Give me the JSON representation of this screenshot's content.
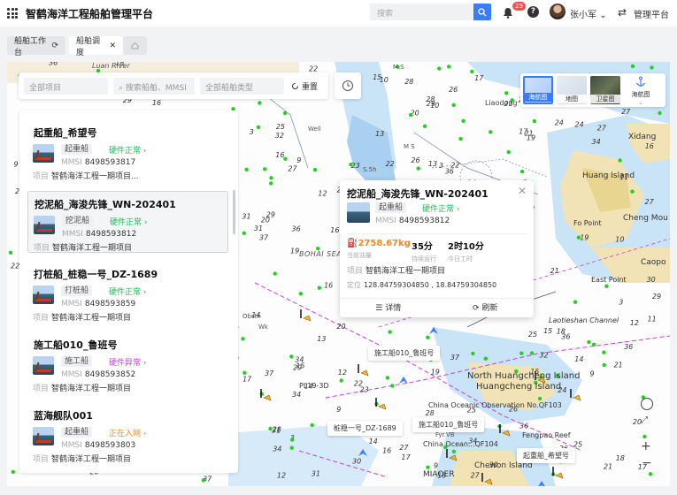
{
  "app": {
    "title": "智鹤海洋工程船舶管理平台"
  },
  "header": {
    "search_placeholder": "搜索",
    "notification_count": "29",
    "help_glyph": "?",
    "username": "张小军",
    "user_chevron": "⌄",
    "switch_label": "管理平台"
  },
  "tabs": [
    {
      "label": "船舶工作台",
      "icon": "refresh-icon"
    },
    {
      "label": "船舶调度",
      "icon": "close-icon"
    },
    {
      "label": "",
      "icon": "home-icon"
    }
  ],
  "filters": {
    "project_placeholder": "全部项目",
    "search_placeholder": "搜索船舶、MMSI",
    "type_placeholder": "全部船舶类型",
    "reset_label": "重置"
  },
  "layers": {
    "chart": "海航图",
    "map": "地图",
    "satellite": "卫星图",
    "chart_tool": "海航图"
  },
  "ships": [
    {
      "name": "起重船_希望号",
      "type": "起重船",
      "hw": "硬件正常 ›",
      "hw_state": "ok",
      "mmsi_label": "MMSI",
      "mmsi": "8498593817",
      "proj_label": "项目",
      "project": "智鹤海洋工程一期项目..."
    },
    {
      "name": "挖泥船_海浚先锋_WN-202401",
      "type": "挖泥船",
      "hw": "硬件正常 ›",
      "hw_state": "ok",
      "mmsi_label": "MMSI",
      "mmsi": "8498593812",
      "proj_label": "项目",
      "project": "智鹤海洋工程一期项目"
    },
    {
      "name": "打桩船_桩稳一号_DZ-1689",
      "type": "打桩船",
      "hw": "硬件正常 ›",
      "hw_state": "ok",
      "mmsi_label": "MMSI",
      "mmsi": "8498593859",
      "proj_label": "项目",
      "project": "智鹤海洋工程一期项目"
    },
    {
      "name": "施工船010_鲁班号",
      "type": "施工船",
      "hw": "硬件异常 ›",
      "hw_state": "bad",
      "mmsi_label": "MMSI",
      "mmsi": "8498593852",
      "proj_label": "项目",
      "project": "智鹤海洋工程一期项目"
    },
    {
      "name": "蓝海舰队001",
      "type": "起重船",
      "hw": "正在入网 ›",
      "hw_state": "net",
      "mmsi_label": "MMSI",
      "mmsi": "8498593803",
      "proj_label": "项目",
      "project": "智鹤海洋工程一期项目"
    }
  ],
  "popup": {
    "title": "挖泥船_海浚先锋_WN-202401",
    "type": "起重船",
    "hw": "硬件正常 ›",
    "mmsi_label": "MMSI",
    "mmsi": "8498593812",
    "oil_value": "2758.67kg",
    "oil_label": "当前油量",
    "run_value": "35分",
    "run_label": "持续运行",
    "work_value": "2时10分",
    "work_label": "今日工时",
    "proj_label": "项目",
    "project": "智鹤海洋工程一期项目",
    "loc_label": "定位",
    "location": "128.84759304850 , 18.84759304850",
    "detail_btn": "详情",
    "refresh_btn": "刷新",
    "close_glyph": "✕"
  },
  "map_ship_labels": [
    "施工船010_鲁班号",
    "桩稳一号_DZ-1689",
    "施工船010_鲁班号",
    "起重船_希望号"
  ],
  "map_texts": {
    "luan_river": "Luan River",
    "bohai": "BOHAI SEA",
    "wuli": "Wuli",
    "liaodong": "Liaodong",
    "xidang": "Xidang",
    "huanglong": "Huang Island",
    "cheng_mou": "Cheng Mou",
    "fo_point": "Fo Point",
    "caopo": "Caopo",
    "east_point": "East Point",
    "laotieshan": "Laotieshan Channel",
    "north_huangcheng": "North Huangcheng Island",
    "huangcheng": "Huangcheng Island",
    "china_station": "China Oceanic Observation No.QF103",
    "qf104": "China Ocean...QF104",
    "pl19": "PL19-3D",
    "fengpao": "Fengpao Reef",
    "miaoer": "MIAOER",
    "chewon": "Chewon Island",
    "ms": "M.S",
    "ms2": "M S",
    "s5h": "S.5h",
    "fyrvb": "Fyr.VB",
    "well": "Well",
    "obstn": "Obstn",
    "wk": "Wk",
    "ssw": "Ssw",
    "fsh": "F.sh"
  },
  "depth_numbers": [
    "25",
    "27",
    "26",
    "28",
    "29",
    "23",
    "24",
    "22",
    "21",
    "20",
    "18",
    "17",
    "19",
    "16",
    "15",
    "30",
    "31",
    "13",
    "12",
    "14",
    "33",
    "34",
    "11",
    "3",
    "32",
    "36",
    "9",
    "10",
    "37"
  ],
  "colors": {
    "accent": "#3b7cff",
    "ok": "#23b45a",
    "bad": "#c43fd6",
    "net": "#f08a1a",
    "ais_dot": "#22d022"
  }
}
